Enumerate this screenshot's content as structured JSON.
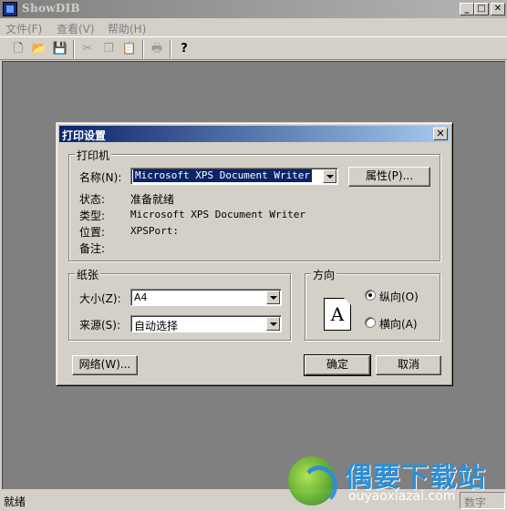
{
  "window": {
    "title": "ShowDIB",
    "buttons": [
      "_",
      "□",
      "✕"
    ]
  },
  "menubar": {
    "items": [
      "文件(F)",
      "查看(V)",
      "帮助(H)"
    ]
  },
  "toolbar": {
    "new": "new-icon",
    "open": "open-folder-icon",
    "save": "save-icon",
    "cut": "cut-icon",
    "copy": "copy-icon",
    "paste": "paste-icon",
    "print": "print-icon",
    "help": "?"
  },
  "dialog": {
    "title": "打印设置",
    "close": "✕",
    "printer_group": {
      "label": "打印机",
      "name_label": "名称(N):",
      "name_value": "Microsoft XPS Document Writer",
      "properties_button": "属性(P)...",
      "status_label": "状态:",
      "status_value": "准备就绪",
      "type_label": "类型:",
      "type_value": "Microsoft XPS Document Writer",
      "location_label": "位置:",
      "location_value": "XPSPort:",
      "comment_label": "备注:",
      "comment_value": ""
    },
    "paper_group": {
      "label": "纸张",
      "size_label": "大小(Z):",
      "size_value": "A4",
      "source_label": "来源(S):",
      "source_value": "自动选择"
    },
    "orientation_group": {
      "label": "方向",
      "portrait": "纵向(O)",
      "landscape": "横向(A)",
      "selected": "portrait",
      "page_glyph": "A"
    },
    "network_button": "网络(W)...",
    "ok_button": "确定",
    "cancel_button": "取消"
  },
  "statusbar": {
    "text": "就绪",
    "panel": "数字"
  },
  "watermark": {
    "title": "偶要下载站",
    "url": "ouyaoxiazai.com"
  }
}
